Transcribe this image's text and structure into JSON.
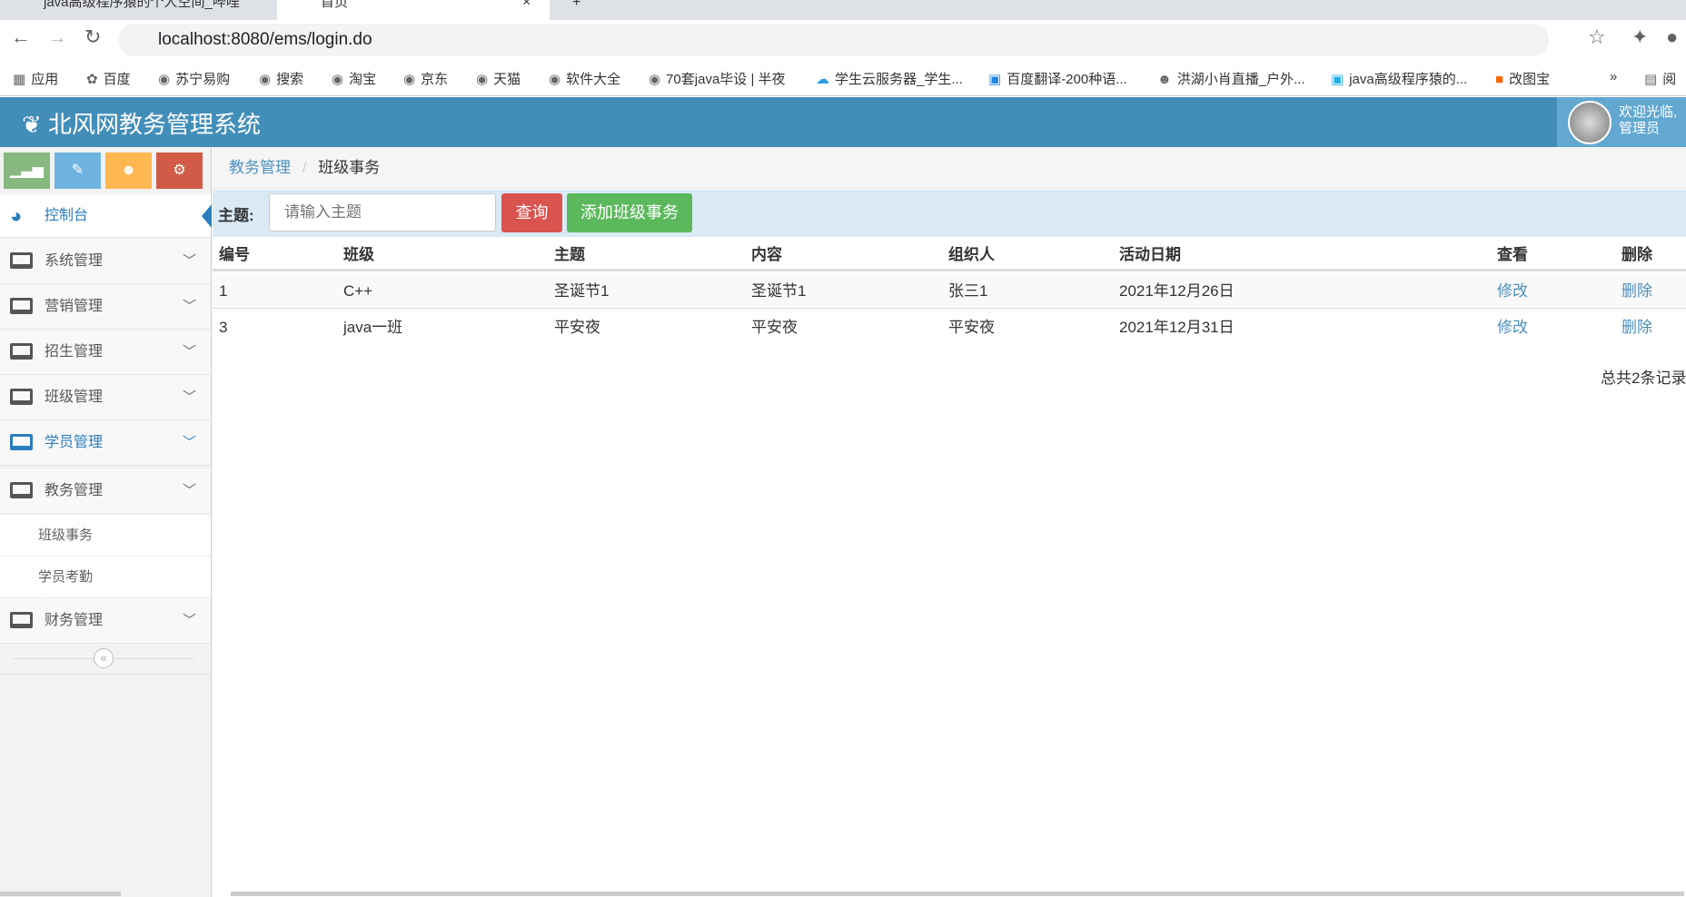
{
  "browser": {
    "tabs": [
      {
        "title": "java高级程序猿的个人空间_哔哩"
      },
      {
        "title": "首页"
      }
    ],
    "url": "localhost:8080/ems/login.do",
    "bookmarks": [
      "应用",
      "百度",
      "苏宁易购",
      "搜索",
      "淘宝",
      "京东",
      "天猫",
      "软件大全",
      "70套java毕设 | 半夜",
      "学生云服务器_学生...",
      "百度翻译-200种语...",
      "洪湖小肖直播_户外...",
      "java高级程序猿的...",
      "改图宝",
      "»",
      "阅"
    ]
  },
  "header": {
    "title": "北风网教务管理系统",
    "welcome": "欢迎光临,",
    "user": "管理员"
  },
  "sidebar": {
    "dashboard": "控制台",
    "menus": [
      "系统管理",
      "营销管理",
      "招生管理",
      "班级管理",
      "学员管理",
      "教务管理"
    ],
    "submenu": [
      "班级事务",
      "学员考勤"
    ],
    "last_menu": "财务管理"
  },
  "breadcrumb": {
    "parent": "教务管理",
    "current": "班级事务"
  },
  "search": {
    "label": "主题:",
    "placeholder": "请输入主题",
    "query_button": "查询",
    "add_button": "添加班级事务"
  },
  "table": {
    "headers": [
      "编号",
      "班级",
      "主题",
      "内容",
      "组织人",
      "活动日期",
      "查看",
      "删除"
    ],
    "rows": [
      [
        "1",
        "C++",
        "圣诞节1",
        "圣诞节1",
        "张三1",
        "2021年12月26日",
        "修改",
        "删除"
      ],
      [
        "3",
        "java一班",
        "平安夜",
        "平安夜",
        "平安夜",
        "2021年12月31日",
        "修改",
        "删除"
      ]
    ]
  },
  "footer": {
    "total": "总共2条记录"
  }
}
